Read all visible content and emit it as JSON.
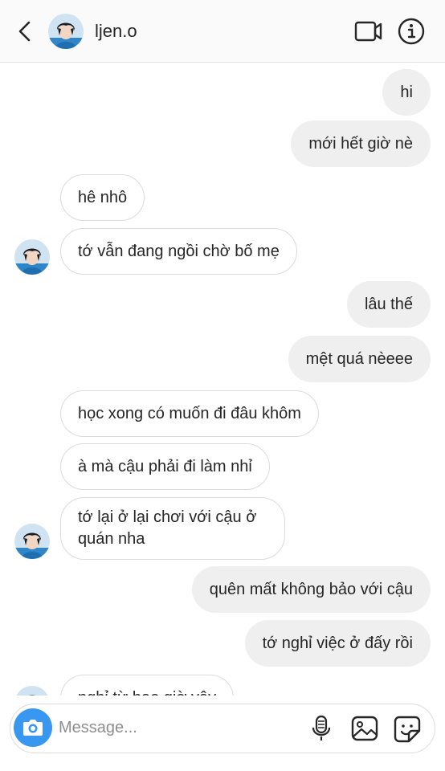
{
  "header": {
    "username": "ljen.o"
  },
  "messages": {
    "m1": "hi",
    "m2": "mới hết giờ nè",
    "m3": "hê nhô",
    "m4": "tớ vẫn đang ngồi chờ bố mẹ",
    "m5": "lâu thế",
    "m6": "mệt quá nèeee",
    "m7": "học xong có muốn đi đâu khôm",
    "m8": "à mà cậu phải đi làm nhỉ",
    "m9": "tớ lại ở lại chơi với cậu ở quán nha",
    "m10": "quên mất không bảo với cậu",
    "m11": "tớ nghỉ việc ở đấy rồi",
    "m12": "nghỉ từ bao giờ vậy"
  },
  "composer": {
    "placeholder": "Message..."
  },
  "colors": {
    "accent": "#3897f0",
    "sent_bubble": "#efefef",
    "received_border": "#dbdbdb"
  }
}
